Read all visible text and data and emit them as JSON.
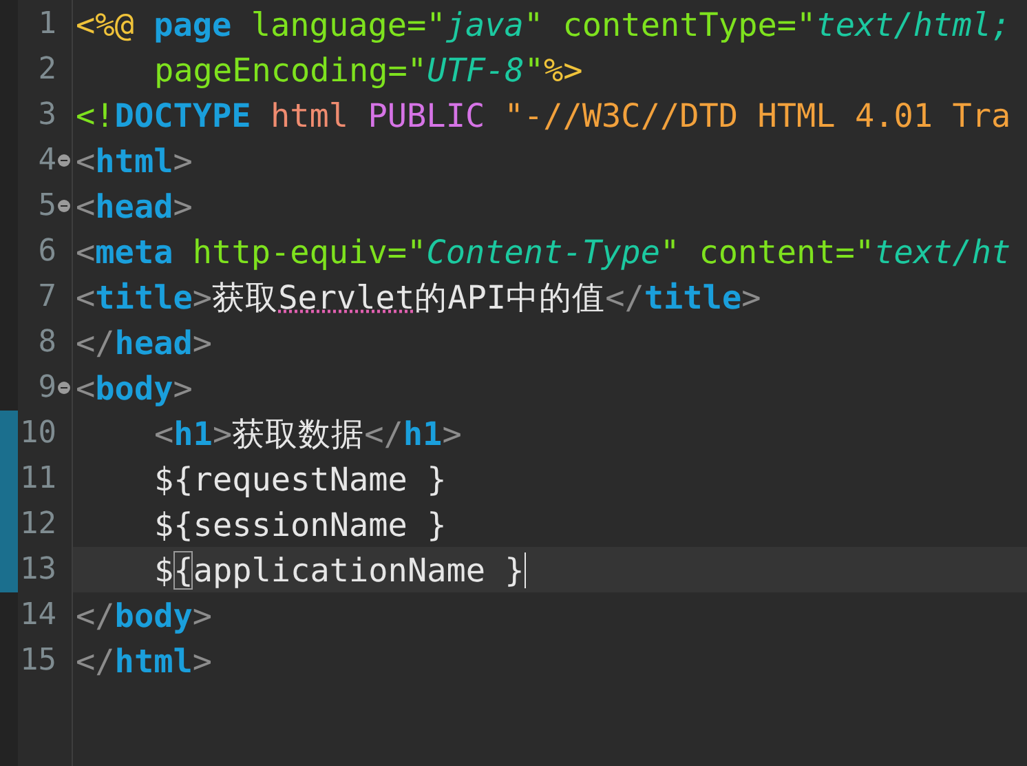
{
  "editor": {
    "lines": [
      {
        "number": "1",
        "foldable": false,
        "changed": false,
        "current": false,
        "indented": false,
        "tokens": [
          {
            "kind": "jsp",
            "text": "<%@"
          },
          {
            "kind": "tag",
            "text": " page"
          },
          {
            "kind": "attr",
            "text": " language=\""
          },
          {
            "kind": "string",
            "text": "java"
          },
          {
            "kind": "attr",
            "text": "\" contentType=\""
          },
          {
            "kind": "string",
            "text": "text/html;"
          }
        ]
      },
      {
        "number": "2",
        "foldable": false,
        "changed": false,
        "current": false,
        "indented": true,
        "tokens": [
          {
            "kind": "attr",
            "text": "pageEncoding=\""
          },
          {
            "kind": "string",
            "text": "UTF-8"
          },
          {
            "kind": "attr",
            "text": "\""
          },
          {
            "kind": "jsp",
            "text": "%>"
          }
        ]
      },
      {
        "number": "3",
        "foldable": false,
        "changed": false,
        "current": false,
        "indented": false,
        "tokens": [
          {
            "kind": "attr",
            "text": "<!"
          },
          {
            "kind": "tag",
            "text": "DOCTYPE"
          },
          {
            "kind": "doctype",
            "text": " html"
          },
          {
            "kind": "keyword",
            "text": " PUBLIC"
          },
          {
            "kind": "literal",
            "text": " \"-//W3C//DTD HTML 4.01 Tra"
          }
        ]
      },
      {
        "number": "4",
        "foldable": true,
        "changed": false,
        "current": false,
        "indented": false,
        "tokens": [
          {
            "kind": "punct",
            "text": "<"
          },
          {
            "kind": "tag",
            "text": "html"
          },
          {
            "kind": "punct",
            "text": ">"
          }
        ]
      },
      {
        "number": "5",
        "foldable": true,
        "changed": false,
        "current": false,
        "indented": false,
        "tokens": [
          {
            "kind": "punct",
            "text": "<"
          },
          {
            "kind": "tag",
            "text": "head"
          },
          {
            "kind": "punct",
            "text": ">"
          }
        ]
      },
      {
        "number": "6",
        "foldable": false,
        "changed": false,
        "current": false,
        "indented": false,
        "tokens": [
          {
            "kind": "punct",
            "text": "<"
          },
          {
            "kind": "tag",
            "text": "meta"
          },
          {
            "kind": "attr",
            "text": " http-equiv=\""
          },
          {
            "kind": "string",
            "text": "Content-Type"
          },
          {
            "kind": "attr",
            "text": "\" content=\""
          },
          {
            "kind": "string",
            "text": "text/ht"
          }
        ]
      },
      {
        "number": "7",
        "foldable": false,
        "changed": false,
        "current": false,
        "indented": false,
        "tokens": [
          {
            "kind": "punct",
            "text": "<"
          },
          {
            "kind": "tag",
            "text": "title"
          },
          {
            "kind": "punct",
            "text": ">"
          },
          {
            "kind": "text",
            "text": "获取"
          },
          {
            "kind": "misspelled",
            "text": "Servlet"
          },
          {
            "kind": "text",
            "text": "的API中的值"
          },
          {
            "kind": "punct",
            "text": "</"
          },
          {
            "kind": "tag",
            "text": "title"
          },
          {
            "kind": "punct",
            "text": ">"
          }
        ]
      },
      {
        "number": "8",
        "foldable": false,
        "changed": false,
        "current": false,
        "indented": false,
        "tokens": [
          {
            "kind": "punct",
            "text": "</"
          },
          {
            "kind": "tag",
            "text": "head"
          },
          {
            "kind": "punct",
            "text": ">"
          }
        ]
      },
      {
        "number": "9",
        "foldable": true,
        "changed": false,
        "current": false,
        "indented": false,
        "tokens": [
          {
            "kind": "punct",
            "text": "<"
          },
          {
            "kind": "tag",
            "text": "body"
          },
          {
            "kind": "punct",
            "text": ">"
          }
        ]
      },
      {
        "number": "10",
        "foldable": false,
        "changed": true,
        "current": false,
        "indented": true,
        "tokens": [
          {
            "kind": "punct",
            "text": "<"
          },
          {
            "kind": "tag",
            "text": "h1"
          },
          {
            "kind": "punct",
            "text": ">"
          },
          {
            "kind": "text",
            "text": "获取数据"
          },
          {
            "kind": "punct",
            "text": "</"
          },
          {
            "kind": "tag",
            "text": "h1"
          },
          {
            "kind": "punct",
            "text": ">"
          }
        ]
      },
      {
        "number": "11",
        "foldable": false,
        "changed": true,
        "current": false,
        "indented": true,
        "tokens": [
          {
            "kind": "text",
            "text": "${requestName }"
          }
        ]
      },
      {
        "number": "12",
        "foldable": false,
        "changed": true,
        "current": false,
        "indented": true,
        "tokens": [
          {
            "kind": "text",
            "text": "${sessionName }"
          }
        ]
      },
      {
        "number": "13",
        "foldable": false,
        "changed": true,
        "current": true,
        "indented": true,
        "tokens": [
          {
            "kind": "text",
            "text": "$"
          },
          {
            "kind": "bracket_match",
            "text": "{"
          },
          {
            "kind": "text",
            "text": "applicationName }"
          }
        ]
      },
      {
        "number": "14",
        "foldable": false,
        "changed": false,
        "current": false,
        "indented": false,
        "tokens": [
          {
            "kind": "punct",
            "text": "</"
          },
          {
            "kind": "tag",
            "text": "body"
          },
          {
            "kind": "punct",
            "text": ">"
          }
        ]
      },
      {
        "number": "15",
        "foldable": false,
        "changed": false,
        "current": false,
        "indented": false,
        "tokens": [
          {
            "kind": "punct",
            "text": "</"
          },
          {
            "kind": "tag",
            "text": "html"
          },
          {
            "kind": "punct",
            "text": ">"
          }
        ]
      }
    ]
  }
}
